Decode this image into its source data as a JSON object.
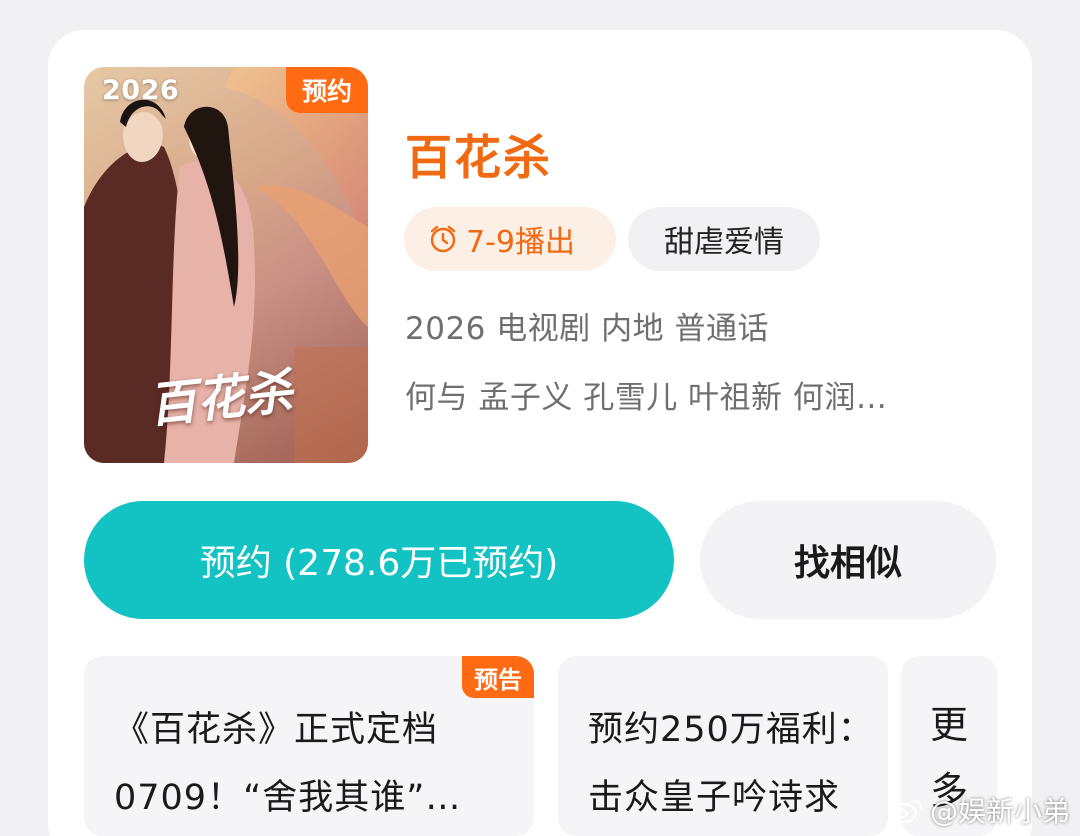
{
  "poster": {
    "year": "2026",
    "badge": "预约",
    "logo_text": "百花杀"
  },
  "show": {
    "title": "百花杀",
    "air_date": "7-9播出",
    "genre": "甜虐爱情",
    "meta": "2026 电视剧 内地 普通话",
    "cast": "何与 孟子义 孔雪儿 叶祖新 何润…"
  },
  "actions": {
    "reserve_label": "预约 (278.6万已预约)",
    "similar_label": "找相似"
  },
  "news": [
    {
      "badge": "预告",
      "line1": "《百花杀》正式定档",
      "line2": "0709！“舍我其谁”…"
    },
    {
      "line1": "预约250万福利：",
      "line2": "击众皇子吟诗求"
    },
    {
      "line1": "更",
      "line2": "多"
    }
  ],
  "watermark": {
    "text": "@娱新小弟"
  },
  "colors": {
    "accent_orange": "#f06a12",
    "badge_orange": "#ff6a12",
    "primary_teal": "#13c2c2"
  },
  "icons": {
    "air_date": "alarm-clock-icon",
    "watermark": "weibo-icon"
  }
}
